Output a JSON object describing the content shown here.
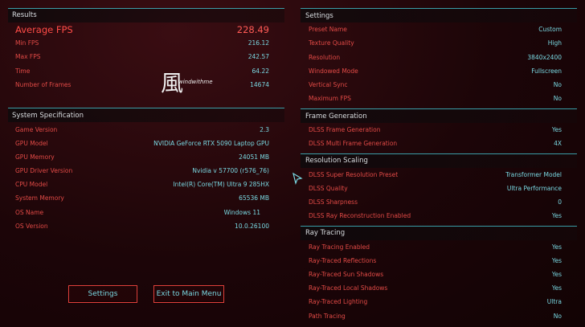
{
  "results": {
    "title": "Results",
    "avg_label": "Average FPS",
    "avg_value": "228.49",
    "rows": [
      {
        "label": "Min FPS",
        "value": "216.12"
      },
      {
        "label": "Max FPS",
        "value": "242.57"
      },
      {
        "label": "Time",
        "value": "64.22"
      },
      {
        "label": "Number of Frames",
        "value": "14674"
      }
    ]
  },
  "watermark": {
    "glyph": "風",
    "text": "windwithme"
  },
  "system": {
    "title": "System Specification",
    "rows": [
      {
        "label": "Game Version",
        "value": "2.3"
      },
      {
        "label": "GPU Model",
        "value": "NVIDIA GeForce RTX 5090 Laptop GPU"
      },
      {
        "label": "GPU Memory",
        "value": "24051 MB"
      },
      {
        "label": "GPU Driver Version",
        "value": "Nvidia v 57700 (r576_76)"
      },
      {
        "label": "CPU Model",
        "value": "Intel(R) Core(TM) Ultra 9 285HX"
      },
      {
        "label": "System Memory",
        "value": "65536 MB"
      },
      {
        "label": "OS Name",
        "value": "Windows 11"
      },
      {
        "label": "OS Version",
        "value": "10.0.26100"
      }
    ]
  },
  "buttons": {
    "settings": "Settings",
    "exit": "Exit to Main Menu"
  },
  "settings": {
    "title": "Settings",
    "rows": [
      {
        "label": "Preset Name",
        "value": "Custom"
      },
      {
        "label": "Texture Quality",
        "value": "High"
      },
      {
        "label": "Resolution",
        "value": "3840x2400"
      },
      {
        "label": "Windowed Mode",
        "value": "Fullscreen"
      },
      {
        "label": "Vertical Sync",
        "value": "No"
      },
      {
        "label": "Maximum FPS",
        "value": "No"
      }
    ]
  },
  "frame_gen": {
    "title": "Frame Generation",
    "rows": [
      {
        "label": "DLSS Frame Generation",
        "value": "Yes"
      },
      {
        "label": "DLSS Multi Frame Generation",
        "value": "4X"
      }
    ]
  },
  "res_scaling": {
    "title": "Resolution Scaling",
    "rows": [
      {
        "label": "DLSS Super Resolution Preset",
        "value": "Transformer Model"
      },
      {
        "label": "DLSS Quality",
        "value": "Ultra Performance"
      },
      {
        "label": "DLSS Sharpness",
        "value": "0"
      },
      {
        "label": "DLSS Ray Reconstruction Enabled",
        "value": "Yes"
      }
    ]
  },
  "ray_tracing": {
    "title": "Ray Tracing",
    "rows": [
      {
        "label": "Ray Tracing Enabled",
        "value": "Yes"
      },
      {
        "label": "Ray-Traced Reflections",
        "value": "Yes"
      },
      {
        "label": "Ray-Traced Sun Shadows",
        "value": "Yes"
      },
      {
        "label": "Ray-Traced Local Shadows",
        "value": "Yes"
      },
      {
        "label": "Ray-Traced Lighting",
        "value": "Ultra"
      },
      {
        "label": "Path Tracing",
        "value": "No"
      }
    ]
  },
  "colors": {
    "label_red": "#e24a46",
    "value_cyan": "#79d8e2",
    "divider": "#3fb7c2"
  }
}
